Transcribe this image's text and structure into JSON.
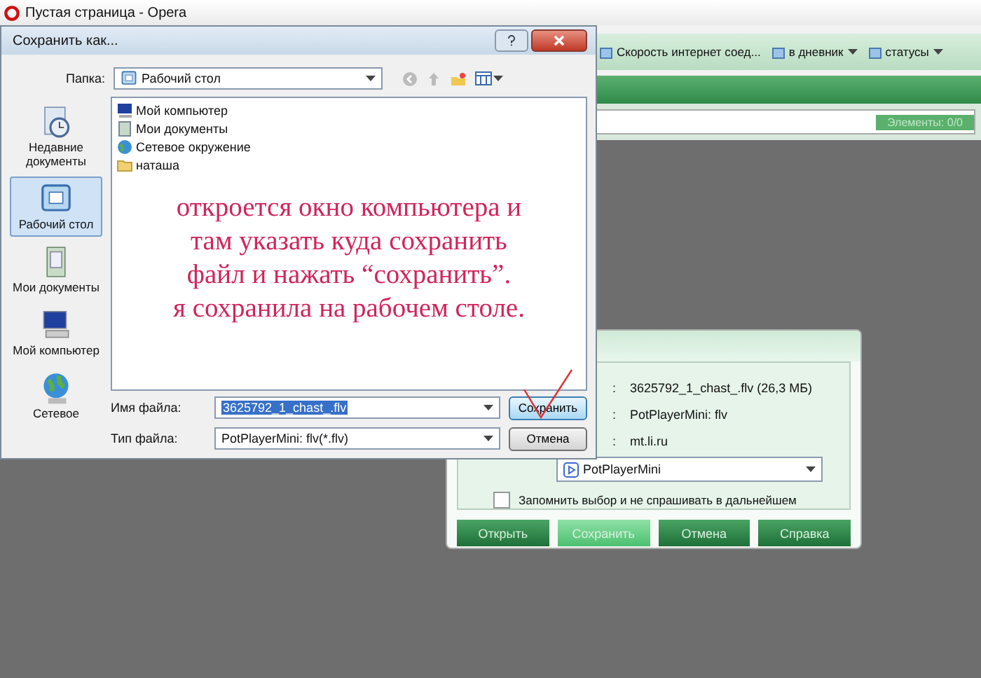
{
  "browser": {
    "title": "Пустая страница - Opera",
    "bookmarks": [
      {
        "label": "Скорость интернет соед...",
        "dropdown": false
      },
      {
        "label": "в дневник",
        "dropdown": true
      },
      {
        "label": "статусы",
        "dropdown": true
      }
    ],
    "elements_badge": "Элементы: 0/0"
  },
  "save_dialog": {
    "title": "Сохранить как...",
    "folder_label": "Папка:",
    "folder_value": "Рабочий стол",
    "places": [
      {
        "label": "Недавние документы",
        "selected": false,
        "kind": "recent"
      },
      {
        "label": "Рабочий стол",
        "selected": true,
        "kind": "desktop"
      },
      {
        "label": "Мои документы",
        "selected": false,
        "kind": "documents"
      },
      {
        "label": "Мой компьютер",
        "selected": false,
        "kind": "computer"
      },
      {
        "label": "Сетевое",
        "selected": false,
        "kind": "network"
      }
    ],
    "files": [
      {
        "name": "Мой компьютер",
        "kind": "computer"
      },
      {
        "name": "Мои документы",
        "kind": "documents"
      },
      {
        "name": "Сетевое окружение",
        "kind": "network"
      },
      {
        "name": "наташа",
        "kind": "folder"
      }
    ],
    "annotation": [
      "откроется окно компьютера и",
      "там указать куда сохранить",
      "файл и нажать “сохранить”.",
      "я сохранила на рабочем столе."
    ],
    "filename_label": "Имя файла:",
    "filename_value": "3625792_1_chast_.flv",
    "filetype_label": "Тип файла:",
    "filetype_value": "PotPlayerMini: flv(*.flv)",
    "buttons": [
      {
        "label": "Сохранить",
        "selected": true
      },
      {
        "label": "Отмена",
        "selected": false
      }
    ]
  },
  "download_dialog": {
    "rows": [
      {
        "label": ":",
        "value": "3625792_1_chast_.flv (26,3 МБ)"
      },
      {
        "label": ":",
        "value": "PotPlayerMini: flv"
      },
      {
        "label": ":",
        "value": "mt.li.ru"
      }
    ],
    "app_select": "PotPlayerMini",
    "remember": {
      "label": "Запомнить выбор и не спрашивать в дальнейшем",
      "checked": false
    },
    "buttons": [
      {
        "label": "Открыть",
        "selected": false
      },
      {
        "label": "Сохранить",
        "selected": true
      },
      {
        "label": "Отмена",
        "selected": false
      },
      {
        "label": "Справка",
        "selected": false
      }
    ]
  }
}
